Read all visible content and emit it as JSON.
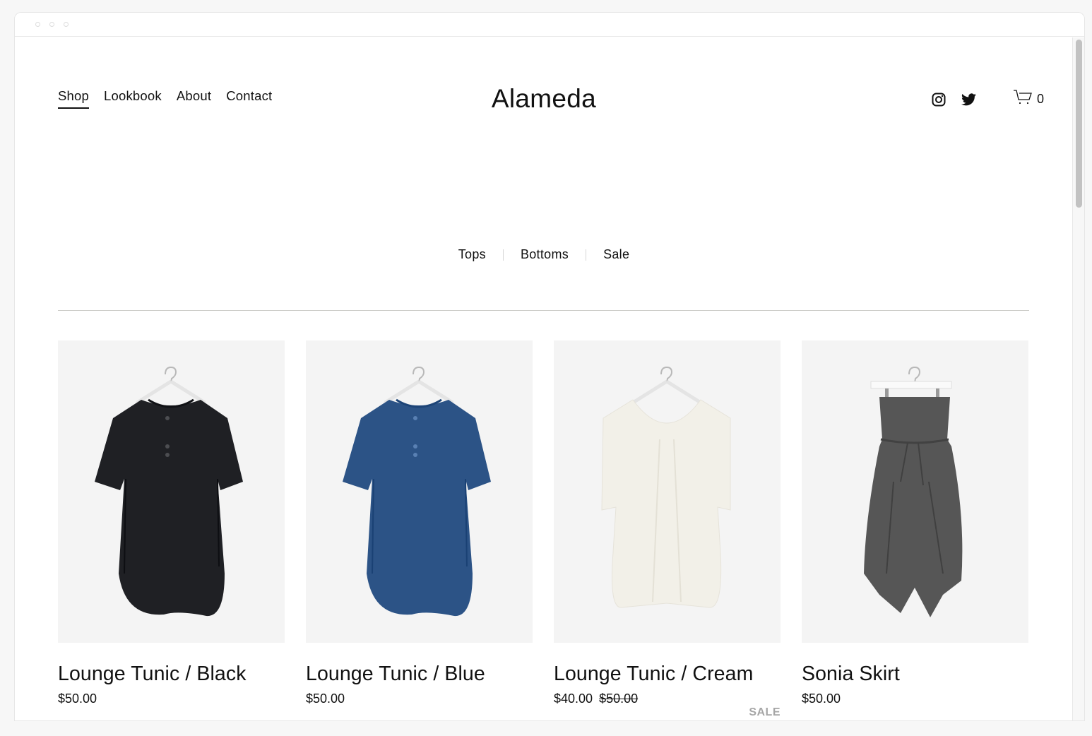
{
  "window": {
    "controls": [
      "close",
      "minimize",
      "maximize"
    ]
  },
  "header": {
    "nav": [
      {
        "label": "Shop",
        "active": true
      },
      {
        "label": "Lookbook",
        "active": false
      },
      {
        "label": "About",
        "active": false
      },
      {
        "label": "Contact",
        "active": false
      }
    ],
    "brand": "Alameda",
    "social": [
      {
        "icon": "instagram-icon"
      },
      {
        "icon": "twitter-icon"
      }
    ],
    "cart": {
      "icon": "cart-icon",
      "count": "0"
    }
  },
  "categories": [
    {
      "label": "Tops"
    },
    {
      "label": "Bottoms"
    },
    {
      "label": "Sale"
    }
  ],
  "products": [
    {
      "title": "Lounge Tunic / Black",
      "price": "$50.00",
      "original_price": null,
      "badge": null,
      "color": "#1f2024",
      "type": "tunic"
    },
    {
      "title": "Lounge Tunic / Blue",
      "price": "$50.00",
      "original_price": null,
      "badge": null,
      "color": "#2c5386",
      "type": "tunic"
    },
    {
      "title": "Lounge Tunic / Cream",
      "price": "$40.00",
      "original_price": "$50.00",
      "badge": "SALE",
      "color": "#f2f0e8",
      "type": "dress"
    },
    {
      "title": "Sonia Skirt",
      "price": "$50.00",
      "original_price": null,
      "badge": null,
      "color": "#565656",
      "type": "skirt"
    }
  ],
  "colors": {
    "text": "#111111",
    "image_bg": "#f4f4f4",
    "sale_badge": "#a6a6a6",
    "divider": "#c9c9c4"
  }
}
